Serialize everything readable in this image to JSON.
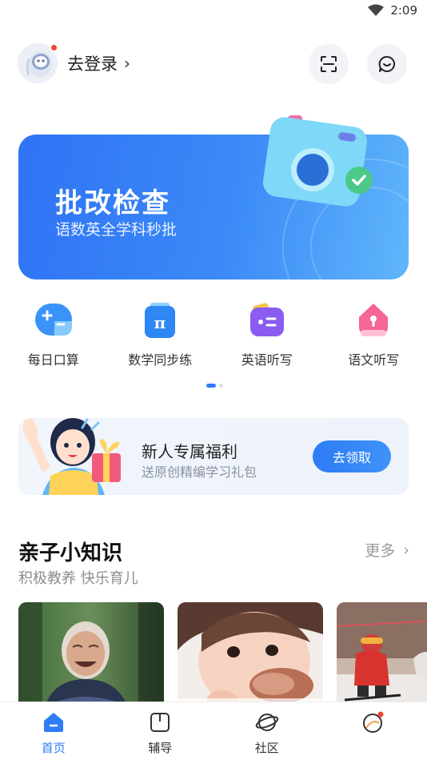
{
  "status_bar": {
    "time": "2:09"
  },
  "header": {
    "login_text": "去登录",
    "login_chevron": "›"
  },
  "banner": {
    "title": "批改检查",
    "subtitle": "语数英全学科秒批"
  },
  "tools": [
    {
      "label": "每日口算",
      "icon": "math-plus-minus-icon",
      "color": "#2f8df7"
    },
    {
      "label": "数学同步练",
      "icon": "pi-icon",
      "color": "#2f86f5"
    },
    {
      "label": "英语听写",
      "icon": "english-card-icon",
      "color": "#8a5cf0"
    },
    {
      "label": "语文听写",
      "icon": "keyhole-icon",
      "color": "#f05a8c"
    }
  ],
  "promo": {
    "title": "新人专属福利",
    "subtitle": "送原创精编学习礼包",
    "button": "去领取"
  },
  "section": {
    "title": "亲子小知识",
    "subtitle": "积极教养 快乐育儿",
    "more": "更多",
    "more_chevron": "›"
  },
  "bottom_nav": [
    {
      "label": "首页",
      "active": true
    },
    {
      "label": "辅导",
      "active": false
    },
    {
      "label": "社区",
      "active": false
    },
    {
      "label": "",
      "active": false
    }
  ],
  "colors": {
    "accent": "#2f7df6",
    "badge": "#f0443c"
  }
}
